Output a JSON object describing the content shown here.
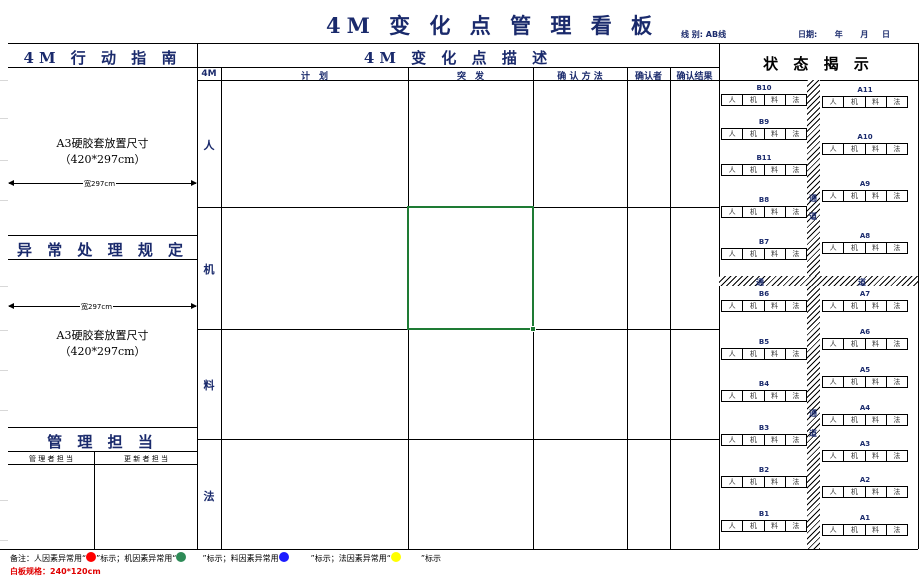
{
  "header": {
    "title": "4M 变 化 点 管 理 看 板",
    "line_label": "线 别:",
    "line_value": "AB线",
    "date_label": "日期:",
    "year_label": "年",
    "month_label": "月",
    "day_label": "日"
  },
  "left_panel": {
    "guide_title": "4M 行 动 指 南",
    "a3_text_1": "A3硬胶套放置尺寸",
    "a3_size_1": "（420*297cm）",
    "width_label_1": "宽297cm",
    "abnormal_title": "异 常 处 理 规 定",
    "width_label_2": "宽297cm",
    "a3_text_2": "A3硬胶套放置尺寸",
    "a3_size_2": "（420*297cm）",
    "mgmt_title": "管 理 担 当",
    "mgmt_col1": "管 理 者 担 当",
    "mgmt_col2": "更 新 者 担 当"
  },
  "center": {
    "desc_title": "4M 变 化 点 描 述",
    "col_4m": "4M",
    "col_plan": "计　划",
    "col_sudden": "突　发",
    "col_method": "确 认 方 法",
    "col_confirmer": "确认者",
    "col_result": "确认结果",
    "rows": [
      "人",
      "机",
      "料",
      "法"
    ]
  },
  "right_panel": {
    "status_title": "状 态 揭 示",
    "cell_labels": [
      "人",
      "机",
      "料",
      "法"
    ],
    "b_top": [
      "B10",
      "B9",
      "B11",
      "B8",
      "B7"
    ],
    "b_bottom": [
      "B6",
      "B5",
      "B4",
      "B3",
      "B2",
      "B1"
    ],
    "a_top": [
      "A11",
      "A10",
      "A9",
      "A8"
    ],
    "a_bottom": [
      "A7",
      "A6",
      "A5",
      "A4",
      "A3",
      "A2",
      "A1"
    ],
    "aisle_marks": [
      "通",
      "道"
    ]
  },
  "footer": {
    "note_prefix": "备注：人因素异常用“",
    "note_human_suffix": "”标示；机因素异常用“",
    "note_machine_suffix": "”标示；料因素异常用",
    "note_material_suffix": "”标示；法因素异常用“",
    "note_method_suffix": "”标示",
    "spec": "白板规格：240*120cm"
  },
  "colors": {
    "human": "#ff0000",
    "machine": "#2e8b57",
    "material": "#1c1cff",
    "method": "#ffff00",
    "selection": "#1e7b34",
    "title_blue": "#1a2a6c"
  }
}
